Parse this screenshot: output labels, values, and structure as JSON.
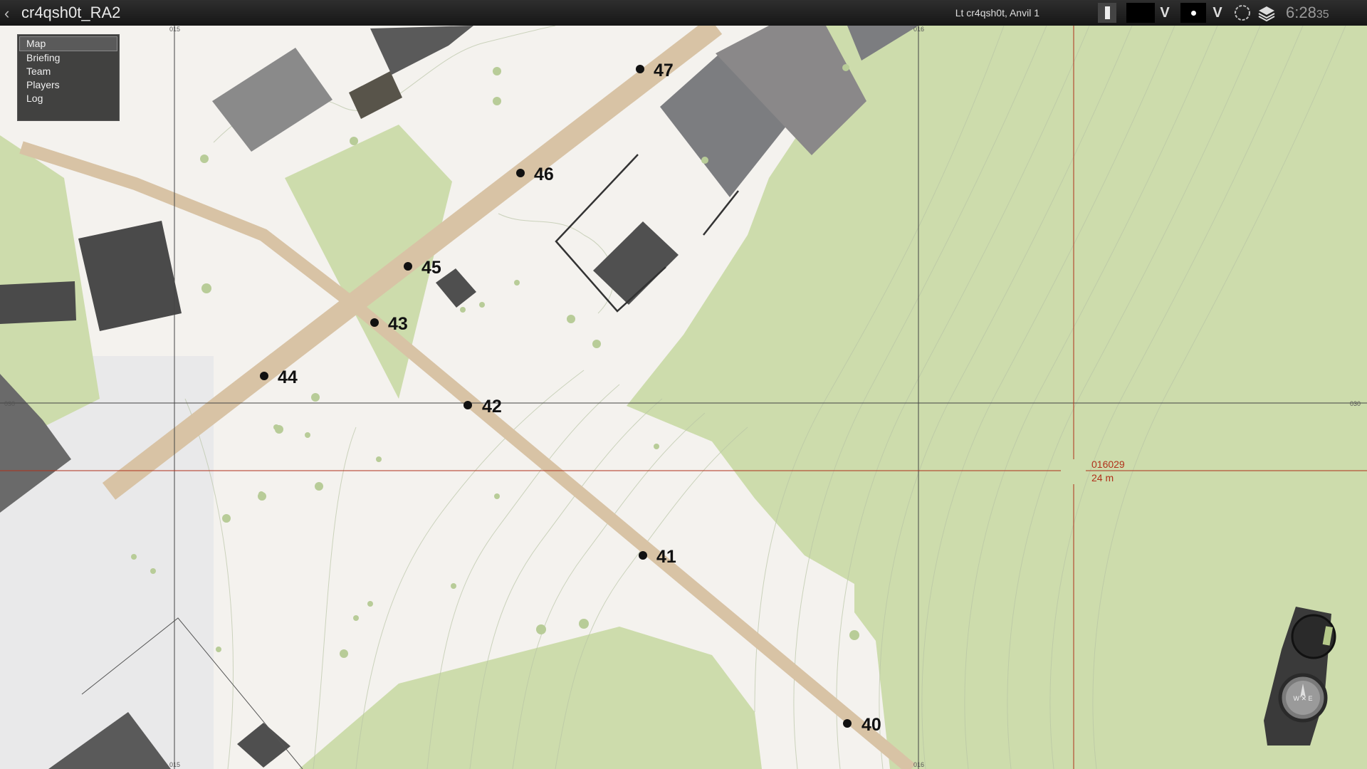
{
  "window": {
    "title": "cr4qsh0t_RA2",
    "player_label": "Lt cr4qsh0t, Anvil 1"
  },
  "clock": {
    "time": "6:28",
    "seconds": "35"
  },
  "menu": {
    "items": [
      "Map",
      "Briefing",
      "Team",
      "Players",
      "Log"
    ],
    "active": "Map"
  },
  "grid": {
    "x_labels": [
      "015",
      "016"
    ],
    "y_labels": [
      "030"
    ]
  },
  "cursor": {
    "grid_ref": "016029",
    "elevation": "24 m"
  },
  "waypoints": [
    "40",
    "41",
    "42",
    "43",
    "44",
    "45",
    "46",
    "47"
  ],
  "colors": {
    "forest": "#cddcac",
    "road": "#d8c3a5",
    "building": "#6f6f6f",
    "cursor_line": "#b0301a"
  }
}
